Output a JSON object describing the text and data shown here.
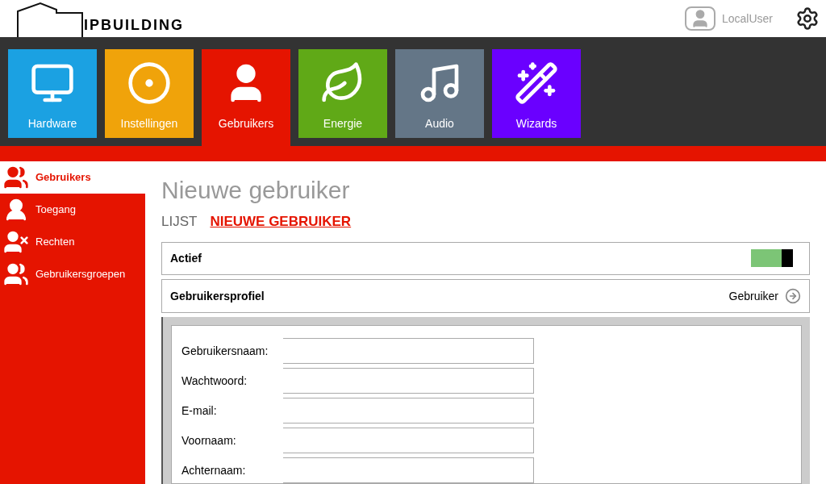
{
  "header": {
    "logo": "IPBUILDING",
    "user": "LocalUser"
  },
  "tiles": [
    {
      "label": "Hardware",
      "kind": "monitor",
      "color": "#1ba1e2",
      "selected": false
    },
    {
      "label": "Instellingen",
      "kind": "dial",
      "color": "#f0a30a",
      "selected": false
    },
    {
      "label": "Gebruikers",
      "kind": "user",
      "color": "#e51400",
      "selected": true
    },
    {
      "label": "Energie",
      "kind": "leaf",
      "color": "#60a917",
      "selected": false
    },
    {
      "label": "Audio",
      "kind": "audio",
      "color": "#647687",
      "selected": false
    },
    {
      "label": "Wizards",
      "kind": "wand",
      "color": "#6a00ff",
      "selected": false
    }
  ],
  "sidebar": {
    "items": [
      {
        "label": "Gebruikers",
        "kind": "users",
        "selected": true
      },
      {
        "label": "Toegang",
        "kind": "key",
        "selected": false
      },
      {
        "label": "Rechten",
        "kind": "ban",
        "selected": false
      },
      {
        "label": "Gebruikersgroepen",
        "kind": "group",
        "selected": false
      }
    ]
  },
  "page": {
    "title": "Nieuwe gebruiker",
    "subtabs": [
      {
        "label": "LIJST",
        "selected": false
      },
      {
        "label": "NIEUWE GEBRUIKER",
        "selected": true
      }
    ],
    "actief": {
      "label": "Actief",
      "on": true
    },
    "profile": {
      "label": "Gebruikersprofiel",
      "value": "Gebruiker"
    },
    "fields": [
      {
        "label": "Gebruikersnaam:"
      },
      {
        "label": "Wachtwoord:"
      },
      {
        "label": "E-mail:"
      },
      {
        "label": "Voornaam:"
      },
      {
        "label": "Achternaam:"
      }
    ]
  }
}
